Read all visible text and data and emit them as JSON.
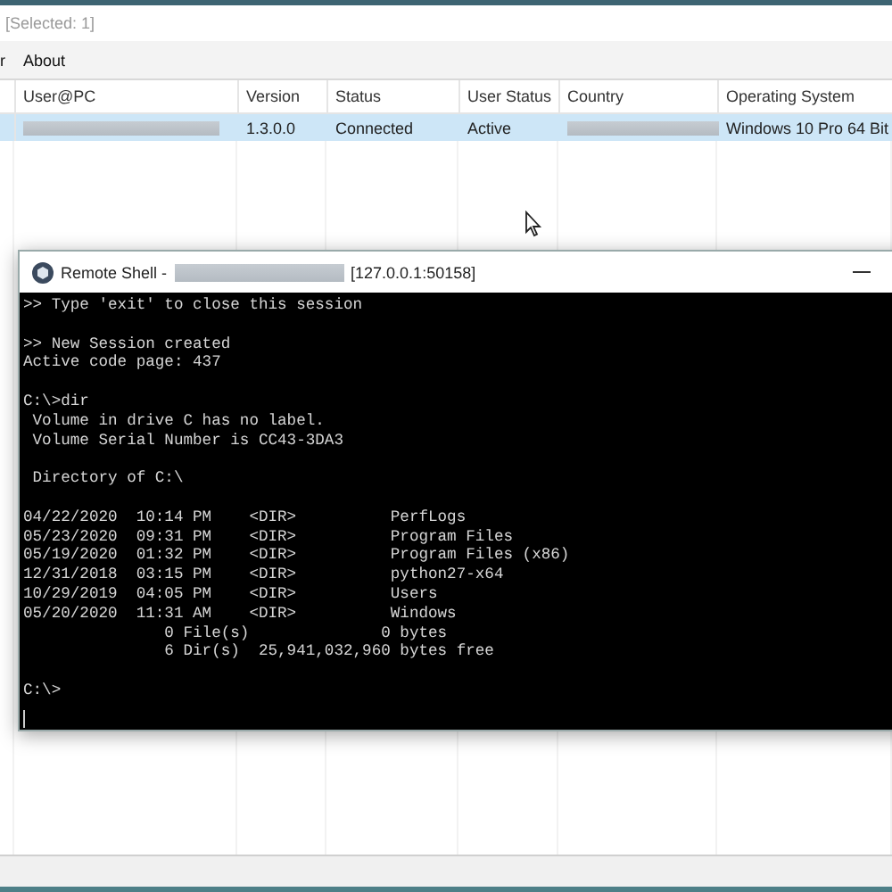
{
  "window": {
    "title": "[Selected: 1]"
  },
  "menu": [
    {
      "label": "r"
    },
    {
      "label": "About"
    }
  ],
  "table": {
    "columns": [
      "User@PC",
      "Version",
      "Status",
      "User Status",
      "Country",
      "Operating System"
    ],
    "rows": [
      {
        "selected": true,
        "cells": [
          {
            "kind": "redacted"
          },
          {
            "kind": "text",
            "text": "1.3.0.0"
          },
          {
            "kind": "text",
            "text": "Connected"
          },
          {
            "kind": "text",
            "text": "Active"
          },
          {
            "kind": "redacted"
          },
          {
            "kind": "text",
            "text": "Windows 10 Pro 64 Bit"
          }
        ]
      }
    ]
  },
  "shell": {
    "title": "Remote Shell -",
    "address": "[127.0.0.1:50158]",
    "blocks": [
      [
        ">> Type 'exit' to close this session"
      ],
      [
        ">> New Session created",
        "Active code page: 437"
      ],
      [
        "C:\\>dir",
        " Volume in drive C has no label.",
        " Volume Serial Number is CC43-3DA3"
      ],
      [
        " Directory of C:\\"
      ],
      [
        "04/22/2020  10:14 PM    <DIR>          PerfLogs",
        "05/23/2020  09:31 PM    <DIR>          Program Files",
        "05/19/2020  01:32 PM    <DIR>          Program Files (x86)",
        "12/31/2018  03:15 PM    <DIR>          python27-x64",
        "10/29/2019  04:05 PM    <DIR>          Users",
        "05/20/2020  11:31 AM    <DIR>          Windows",
        "               0 File(s)              0 bytes",
        "               6 Dir(s)  25,941,032,960 bytes free"
      ],
      [
        "C:\\>"
      ]
    ]
  }
}
